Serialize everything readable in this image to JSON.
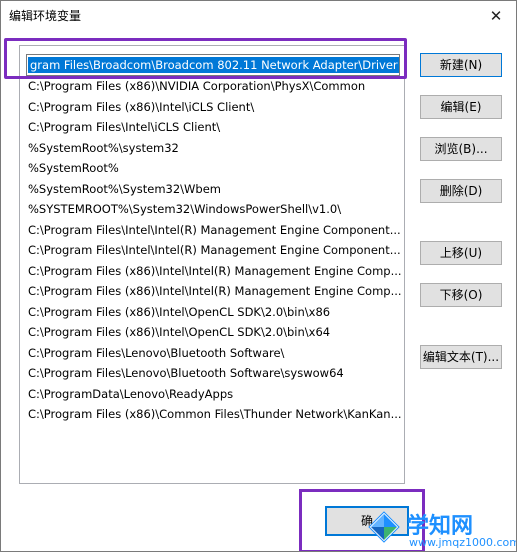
{
  "window": {
    "title": "编辑环境变量",
    "close_glyph": "✕"
  },
  "list": {
    "editing_value": "gram Files\\Broadcom\\Broadcom 802.11 Network Adapter\\Driver",
    "items": [
      "C:\\Program Files (x86)\\NVIDIA Corporation\\PhysX\\Common",
      "C:\\Program Files (x86)\\Intel\\iCLS Client\\",
      "C:\\Program Files\\Intel\\iCLS Client\\",
      "%SystemRoot%\\system32",
      "%SystemRoot%",
      "%SystemRoot%\\System32\\Wbem",
      "%SYSTEMROOT%\\System32\\WindowsPowerShell\\v1.0\\",
      "C:\\Program Files\\Intel\\Intel(R) Management Engine Component...",
      "C:\\Program Files\\Intel\\Intel(R) Management Engine Component...",
      "C:\\Program Files (x86)\\Intel\\Intel(R) Management Engine Comp...",
      "C:\\Program Files (x86)\\Intel\\Intel(R) Management Engine Comp...",
      "C:\\Program Files (x86)\\Intel\\OpenCL SDK\\2.0\\bin\\x86",
      "C:\\Program Files (x86)\\Intel\\OpenCL SDK\\2.0\\bin\\x64",
      "C:\\Program Files\\Lenovo\\Bluetooth Software\\",
      "C:\\Program Files\\Lenovo\\Bluetooth Software\\syswow64",
      "C:\\ProgramData\\Lenovo\\ReadyApps",
      "C:\\Program Files (x86)\\Common Files\\Thunder Network\\KanKan..."
    ]
  },
  "buttons": {
    "new": "新建(N)",
    "edit": "编辑(E)",
    "browse": "浏览(B)...",
    "delete": "删除(D)",
    "move_up": "上移(U)",
    "move_down": "下移(O)",
    "edit_text": "编辑文本(T)...",
    "ok": "确"
  },
  "watermark": {
    "text": "学知网",
    "url": "www.jmqz1000.com"
  },
  "colors": {
    "highlight": "#7b2cbf",
    "selection": "#0078d7",
    "watermark": "#1e90ff"
  }
}
